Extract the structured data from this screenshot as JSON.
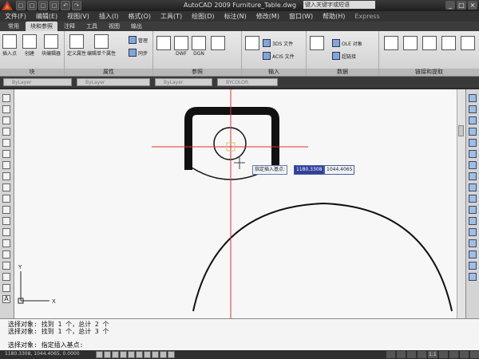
{
  "window": {
    "title": "AutoCAD 2009 Furniture_Table.dwg",
    "search_placeholder": "键入关键字或短语",
    "controls": [
      "_",
      "□",
      "×"
    ]
  },
  "quick_access": [
    "□",
    "□",
    "□",
    "□",
    "↶",
    "↷"
  ],
  "menu": [
    "文件(F)",
    "编辑(E)",
    "视图(V)",
    "插入(I)",
    "格式(O)",
    "工具(T)",
    "绘图(D)",
    "标注(N)",
    "修改(M)",
    "窗口(W)",
    "帮助(H)",
    "Express"
  ],
  "ribbon_tabs": [
    "常用",
    "块和参照",
    "注释",
    "工具",
    "视图",
    "输出"
  ],
  "ribbon_active_tab": "块和参照",
  "panels": [
    {
      "label": "块",
      "buttons": [
        "插入点",
        "创建",
        "块编辑器"
      ]
    },
    {
      "label": "属性",
      "buttons": [
        "定义属性",
        "编辑单个属性",
        "管理",
        "同步"
      ]
    },
    {
      "label": "参照",
      "buttons": [
        "DWF",
        "DGN",
        "参照"
      ]
    },
    {
      "label": "输入",
      "buttons": [
        "3DS 文件",
        "ACIS 文件"
      ]
    },
    {
      "label": "数据",
      "buttons": [
        "OLE 对象",
        "超链接"
      ]
    },
    {
      "label": "链接和提取",
      "buttons": []
    }
  ],
  "properties": {
    "color": "ByLayer",
    "linetype": "ByLayer",
    "lineweight": "ByLayer",
    "plotstyle": "BYCOLOR"
  },
  "dynamic_input": {
    "prompt": "指定插入基点:",
    "x_value": "1180.3308",
    "y_value": "1044.4065"
  },
  "command_lines": [
    "选择对象: 找到 1 个，总计 2 个",
    "选择对象: 找到 1 个，总计 3 个",
    "选择对象:  指定插入基点:"
  ],
  "status": {
    "coords": "1180.3308, 1044.4065, 0.0000",
    "scale_label": "1:1"
  },
  "colors": {
    "crosshair": "#e03030",
    "selected_input": "#2f3f9c"
  }
}
